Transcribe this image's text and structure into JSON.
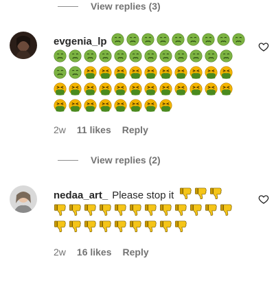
{
  "thread1": {
    "view_replies": "View replies (3)"
  },
  "comment1": {
    "username": "evgenia_lp",
    "emoji_rows": [
      [
        "sick",
        "sick",
        "sick",
        "sick",
        "sick",
        "sick",
        "sick",
        "sick",
        "sick"
      ],
      [
        "sick",
        "sick",
        "sick",
        "sick",
        "sick",
        "sick",
        "sick",
        "sick",
        "sick",
        "sick",
        "sick",
        "sick"
      ],
      [
        "sick",
        "sick",
        "vomit",
        "vomit",
        "vomit",
        "vomit",
        "vomit",
        "vomit",
        "vomit",
        "vomit",
        "vomit",
        "vomit"
      ],
      [
        "vomit",
        "vomit",
        "vomit",
        "vomit",
        "vomit",
        "vomit",
        "vomit",
        "vomit",
        "vomit",
        "vomit",
        "vomit",
        "vomit"
      ],
      [
        "vomit",
        "vomit",
        "vomit",
        "vomit",
        "vomit",
        "vomit",
        "vomit",
        "vomit"
      ]
    ],
    "time": "2w",
    "likes": "11 likes",
    "reply": "Reply"
  },
  "thread2": {
    "view_replies": "View replies (2)"
  },
  "comment2": {
    "username": "nedaa_art_",
    "text": "Please stop it",
    "emoji_rows": [
      [
        "thumbs-down",
        "thumbs-down",
        "thumbs-down"
      ],
      [
        "thumbs-down",
        "thumbs-down",
        "thumbs-down",
        "thumbs-down",
        "thumbs-down",
        "thumbs-down",
        "thumbs-down",
        "thumbs-down",
        "thumbs-down",
        "thumbs-down",
        "thumbs-down",
        "thumbs-down"
      ],
      [
        "thumbs-down",
        "thumbs-down",
        "thumbs-down",
        "thumbs-down",
        "thumbs-down",
        "thumbs-down",
        "thumbs-down",
        "thumbs-down",
        "thumbs-down"
      ]
    ],
    "time": "2w",
    "likes": "16 likes",
    "reply": "Reply"
  },
  "colors": {
    "sick_face": "#7cb342",
    "vomit_face": "#f4b400",
    "vomit_splash": "#4a8a1e",
    "thumbs_down": "#f5c518",
    "muted_text": "#737373"
  }
}
